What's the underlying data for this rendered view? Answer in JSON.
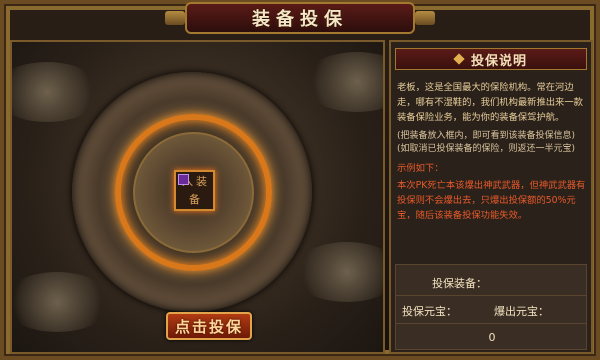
{
  "window": {
    "title": "装备投保"
  },
  "stage": {
    "slot_glyphs": [
      "入",
      "装",
      "备"
    ],
    "action_button": "点击投保"
  },
  "panel": {
    "title": "投保说明",
    "paragraph1": "老板，这是全国最大的保险机构。常在河边走，哪有不湿鞋的，我们机构最新推出来一款装备保险业务，能为你的装备保驾护航。",
    "tip1": "(把装备放入框内，即可看到该装备投保信息)",
    "tip2": "(如取消已投保装备的保险，则返还一半元宝)",
    "example_title": "示例如下：",
    "example_text": "本次PK死亡本该爆出神武武器，但神武武器有投保则不会爆出去，只爆出投保额的50%元宝，随后该装备投保功能失效。",
    "fields": {
      "equip_label": "投保装备：",
      "yuanbao_label": "投保元宝：",
      "drop_label": "爆出元宝：",
      "yuanbao_value": "0"
    }
  }
}
